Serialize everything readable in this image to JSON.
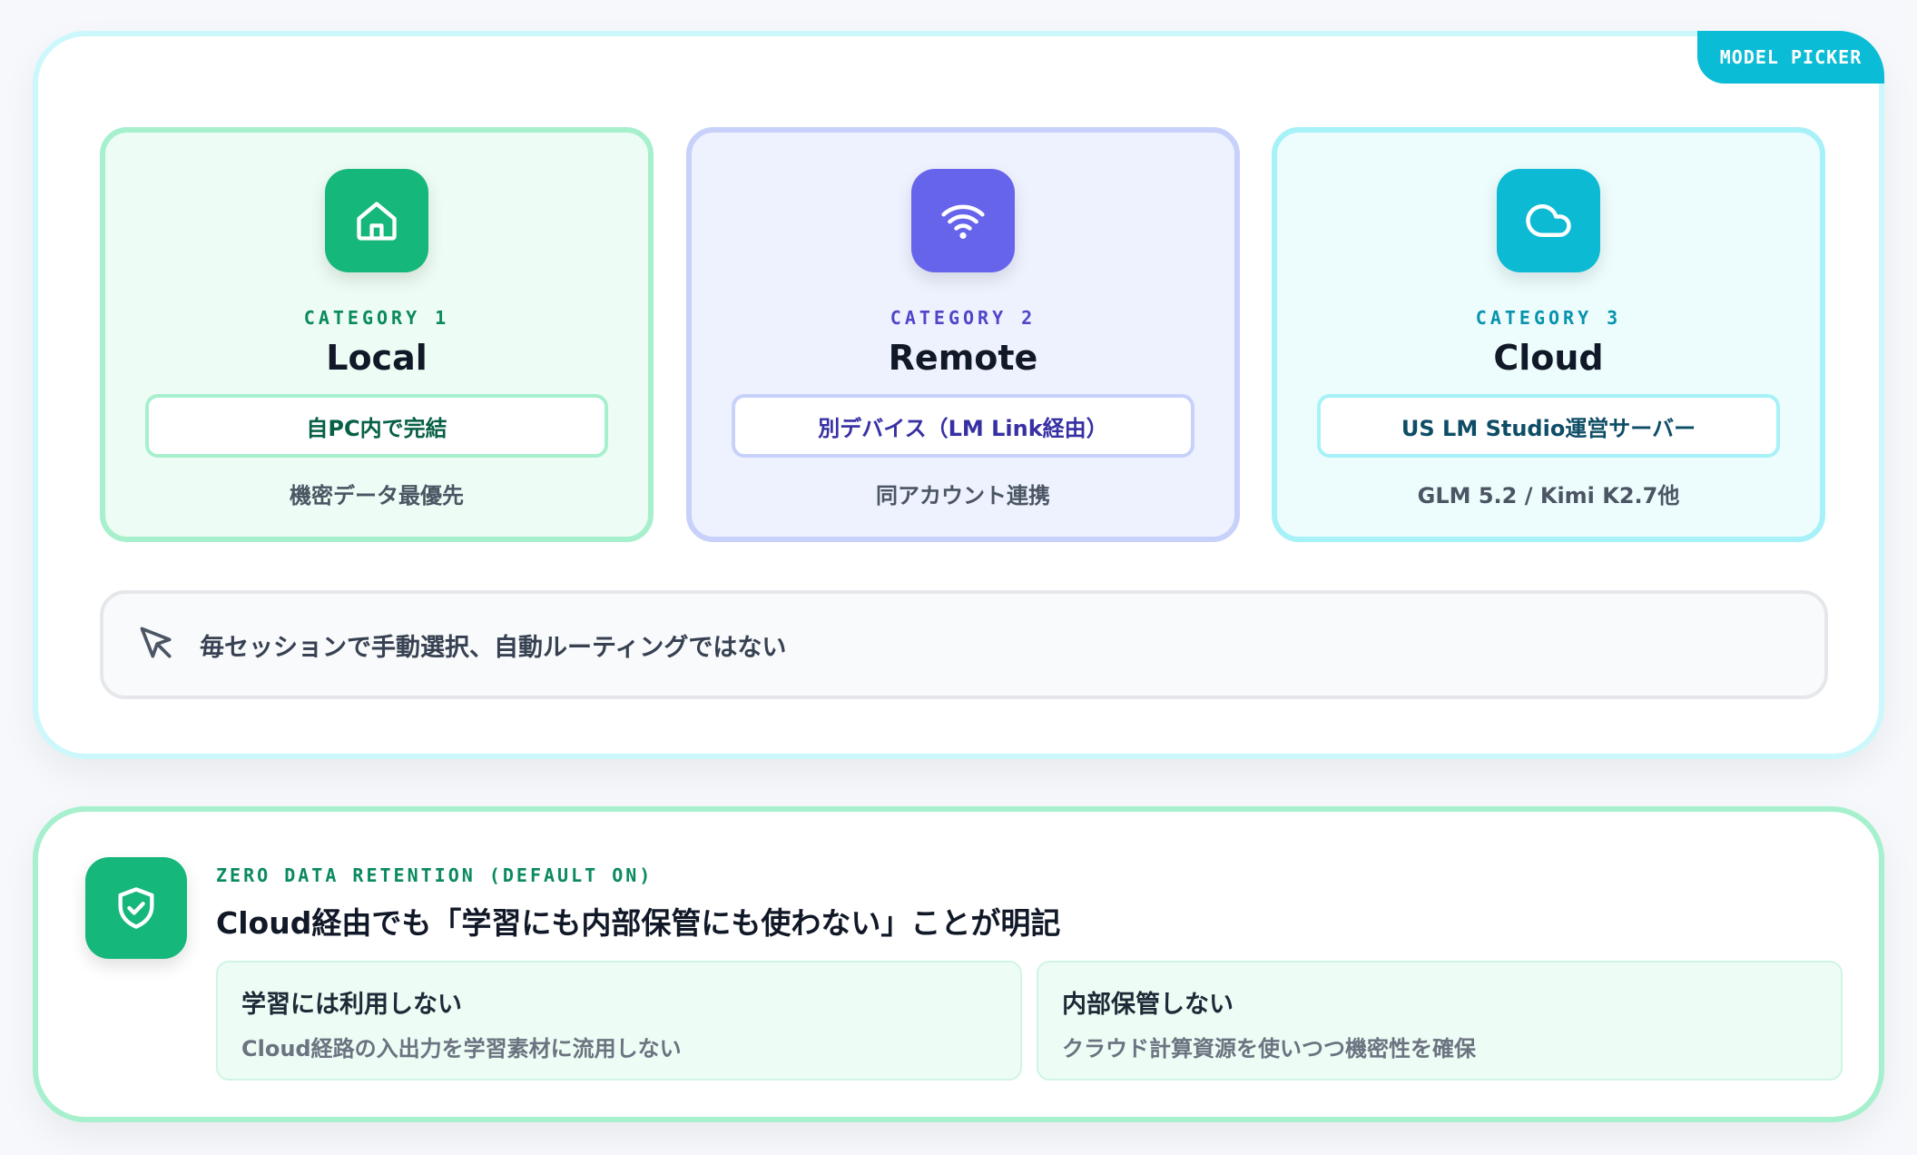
{
  "model_picker": {
    "tag": "MODEL PICKER",
    "categories": [
      {
        "icon": "home-icon",
        "label": "CATEGORY 1",
        "title": "Local",
        "pill": "自PC内で完結",
        "note": "機密データ最優先",
        "accent": "#16b77a"
      },
      {
        "icon": "wifi-icon",
        "label": "CATEGORY 2",
        "title": "Remote",
        "pill": "別デバイス（LM Link経由）",
        "note": "同アカウント連携",
        "accent": "#6764ec"
      },
      {
        "icon": "cloud-icon",
        "label": "CATEGORY 3",
        "title": "Cloud",
        "pill": "US LM Studio運営サーバー",
        "note": "GLM 5.2 / Kimi K2.7他",
        "accent": "#0cbad4"
      }
    ],
    "manual_note": "毎セッションで手動選択、自動ルーティングではない"
  },
  "zdr": {
    "icon": "shield-check-icon",
    "label": "ZERO DATA RETENTION (DEFAULT ON)",
    "title": "Cloud経由でも「学習にも内部保管にも使わない」ことが明記",
    "items": [
      {
        "heading": "学習には利用しない",
        "sub": "Cloud経路の入出力を学習素材に流用しない"
      },
      {
        "heading": "内部保管しない",
        "sub": "クラウド計算資源を使いつつ機密性を確保"
      }
    ],
    "accent": "#16b77a"
  }
}
